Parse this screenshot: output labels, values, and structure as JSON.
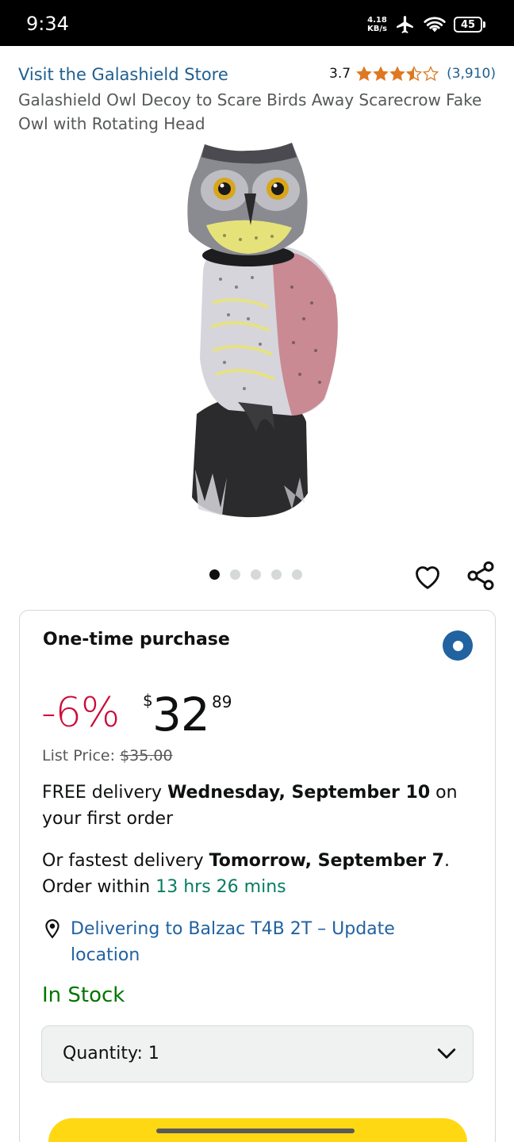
{
  "status_bar": {
    "time": "9:34",
    "net_speed_value": "4.18",
    "net_speed_unit": "KB/s",
    "battery": "45",
    "icons": [
      "airplane-icon",
      "wifi-icon",
      "battery-icon"
    ]
  },
  "product": {
    "store_link": "Visit the Galashield Store",
    "rating_value": "3.7",
    "rating_stars": 3.5,
    "rating_count": "(3,910)",
    "title": "Galashield Owl Decoy to Scare Birds Away Scarecrow Fake Owl with Rotating Head",
    "image_count": 5,
    "active_image": 1
  },
  "buybox": {
    "purchase_option": "One-time purchase",
    "discount": "-6%",
    "currency": "$",
    "price_whole": "32",
    "price_fraction": "89",
    "list_price_label": "List Price:",
    "list_price": "$35.00",
    "delivery_prefix": "FREE delivery ",
    "delivery_date": "Wednesday, September 10",
    "delivery_suffix": " on your first order",
    "fastest_prefix": "Or fastest delivery ",
    "fastest_date": "Tomorrow, September 7",
    "fastest_middle": ". Order within ",
    "fastest_countdown": "13 hrs 26 mins",
    "location_text": "Delivering to Balzac T4B 2T – Update location",
    "stock_status": "In Stock",
    "quantity_label": "Quantity:",
    "quantity_value": "1"
  },
  "colors": {
    "link": "#2162a1",
    "discount": "#cc0c39",
    "in_stock": "#007600",
    "countdown": "#067d62",
    "star": "#de7921",
    "add_to_cart": "#ffd814"
  }
}
